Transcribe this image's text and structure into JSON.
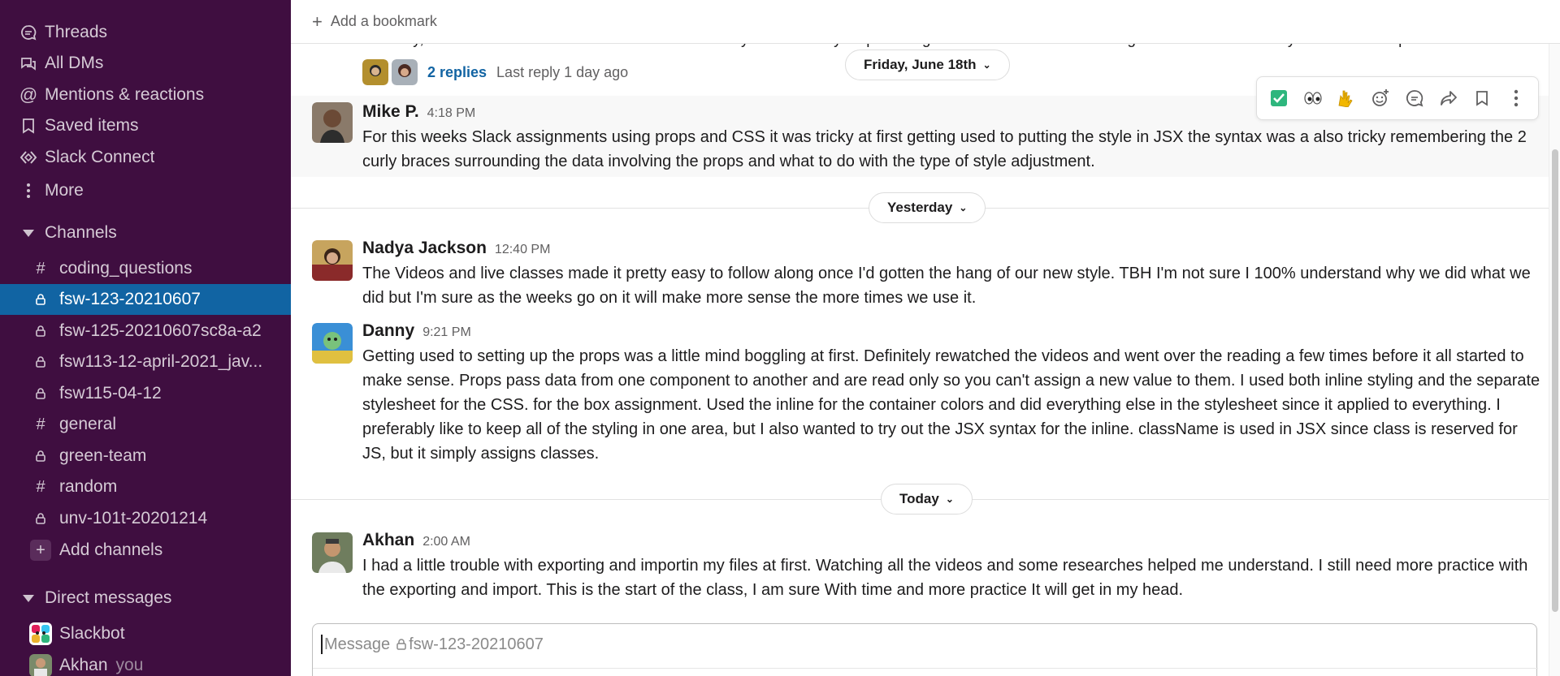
{
  "sidebar": {
    "nav": [
      {
        "icon": "threads-icon",
        "label": "Threads"
      },
      {
        "icon": "dms-icon",
        "label": "All DMs"
      },
      {
        "icon": "at-icon",
        "label": "Mentions & reactions"
      },
      {
        "icon": "bookmark-icon",
        "label": "Saved items"
      },
      {
        "icon": "slack-connect-icon",
        "label": "Slack Connect"
      },
      {
        "icon": "more-icon",
        "label": "More"
      }
    ],
    "channels_header": "Channels",
    "channels": [
      {
        "type": "public",
        "name": "coding_questions",
        "active": false
      },
      {
        "type": "private",
        "name": "fsw-123-20210607",
        "active": true
      },
      {
        "type": "private",
        "name": "fsw-125-20210607sc8a-a2",
        "active": false
      },
      {
        "type": "private",
        "name": "fsw113-12-april-2021_jav...",
        "active": false
      },
      {
        "type": "private",
        "name": "fsw115-04-12",
        "active": false
      },
      {
        "type": "public",
        "name": "general",
        "active": false
      },
      {
        "type": "private",
        "name": "green-team",
        "active": false
      },
      {
        "type": "public",
        "name": "random",
        "active": false
      },
      {
        "type": "private",
        "name": "unv-101t-20201214",
        "active": false
      }
    ],
    "add_channels": "Add channels",
    "dm_header": "Direct messages",
    "dms": [
      {
        "name": "Slackbot",
        "suffix": ""
      },
      {
        "name": "Akhan",
        "suffix": "you"
      }
    ]
  },
  "header": {
    "add_bookmark": "Add a bookmark"
  },
  "thread_fragment": {
    "text": "correctly, I attended office hours with Professor McHardy and he really helped me get out of that rabbit hole and gave me some real easy to understand pointers.",
    "replies": "2 replies",
    "last_reply": "Last reply 1 day ago"
  },
  "date_pills": {
    "friday": "Friday, June 18th",
    "yesterday": "Yesterday",
    "today": "Today"
  },
  "toolbar": {
    "icons": [
      "check-reaction-icon",
      "eyes-reaction-icon",
      "raised-hands-reaction-icon",
      "add-reaction-icon",
      "reply-thread-icon",
      "share-icon",
      "save-icon",
      "more-actions-icon"
    ],
    "colors": {
      "check": "#2eb67d",
      "hands": "#f2b700"
    }
  },
  "messages": [
    {
      "author": "Mike P.",
      "time": "4:18 PM",
      "text": "For this weeks Slack assignments using props and CSS it was tricky at first getting used to putting the style in JSX the syntax was a also tricky remembering the 2 curly braces surrounding the data involving the props and what to do with the type of style adjustment."
    },
    {
      "author": "Nadya Jackson",
      "time": "12:40 PM",
      "text": "The Videos and live classes made it pretty easy to follow along once I'd gotten the hang of our new style. TBH I'm not sure I 100% understand why we did what we did but I'm sure as the weeks go on it will make more sense the more times we use it."
    },
    {
      "author": "Danny",
      "time": "9:21 PM",
      "text": "Getting used to setting up the props was a little mind boggling at first. Definitely rewatched the videos and went over the reading a few times before it all started to make sense. Props pass data from one component to another and are read only so you can't assign a new value to them. I used both inline styling and the separate stylesheet for the CSS. for the box assignment. Used the inline for the container colors and did everything else in the stylesheet since it applied to everything. I preferably like to keep all of the styling in one area, but I also wanted to try out the JSX syntax for the inline. className is used in JSX since class is reserved for JS, but it simply assigns classes."
    },
    {
      "author": "Akhan",
      "time": "2:00 AM",
      "text": "I had a little trouble with exporting and importin my files at first. Watching all the videos and some researches helped me understand. I still need more practice with the exporting and import. This is the start of the class, I am sure With time and more practice It will get in my head."
    }
  ],
  "composer": {
    "placeholder_prefix": "Message",
    "channel": "fsw-123-20210607"
  },
  "colors": {
    "sidebar_bg": "#3f0e40",
    "active_bg": "#1164a3",
    "link": "#1264a3"
  }
}
